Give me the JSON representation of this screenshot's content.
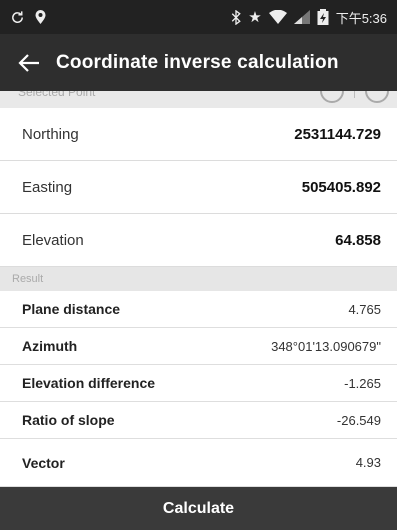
{
  "status_bar": {
    "left_icons": [
      "sync-icon",
      "location-pin-icon"
    ],
    "right_icons": [
      "bluetooth-icon",
      "star-icon",
      "wifi-icon",
      "signal-icon",
      "battery-icon"
    ],
    "time": "下午5:36"
  },
  "app_bar": {
    "back_icon": "arrow-left-icon",
    "title": "Coordinate inverse calculation"
  },
  "partial_section": {
    "label": "Selected Point",
    "icons": [
      "download-icon",
      "locate-icon"
    ]
  },
  "coordinates": {
    "northing": {
      "label": "Northing",
      "value": "2531144.729"
    },
    "easting": {
      "label": "Easting",
      "value": "505405.892"
    },
    "elevation": {
      "label": "Elevation",
      "value": "64.858"
    }
  },
  "result": {
    "header": "Result",
    "rows": [
      {
        "label": "Plane distance",
        "value": "4.765"
      },
      {
        "label": "Azimuth",
        "value": "348°01'13.090679\""
      },
      {
        "label": "Elevation difference",
        "value": "-1.265"
      },
      {
        "label": "Ratio of slope",
        "value": "-26.549"
      },
      {
        "label": "Vector",
        "value": "4.93"
      }
    ]
  },
  "calculate_button": {
    "label": "Calculate"
  }
}
